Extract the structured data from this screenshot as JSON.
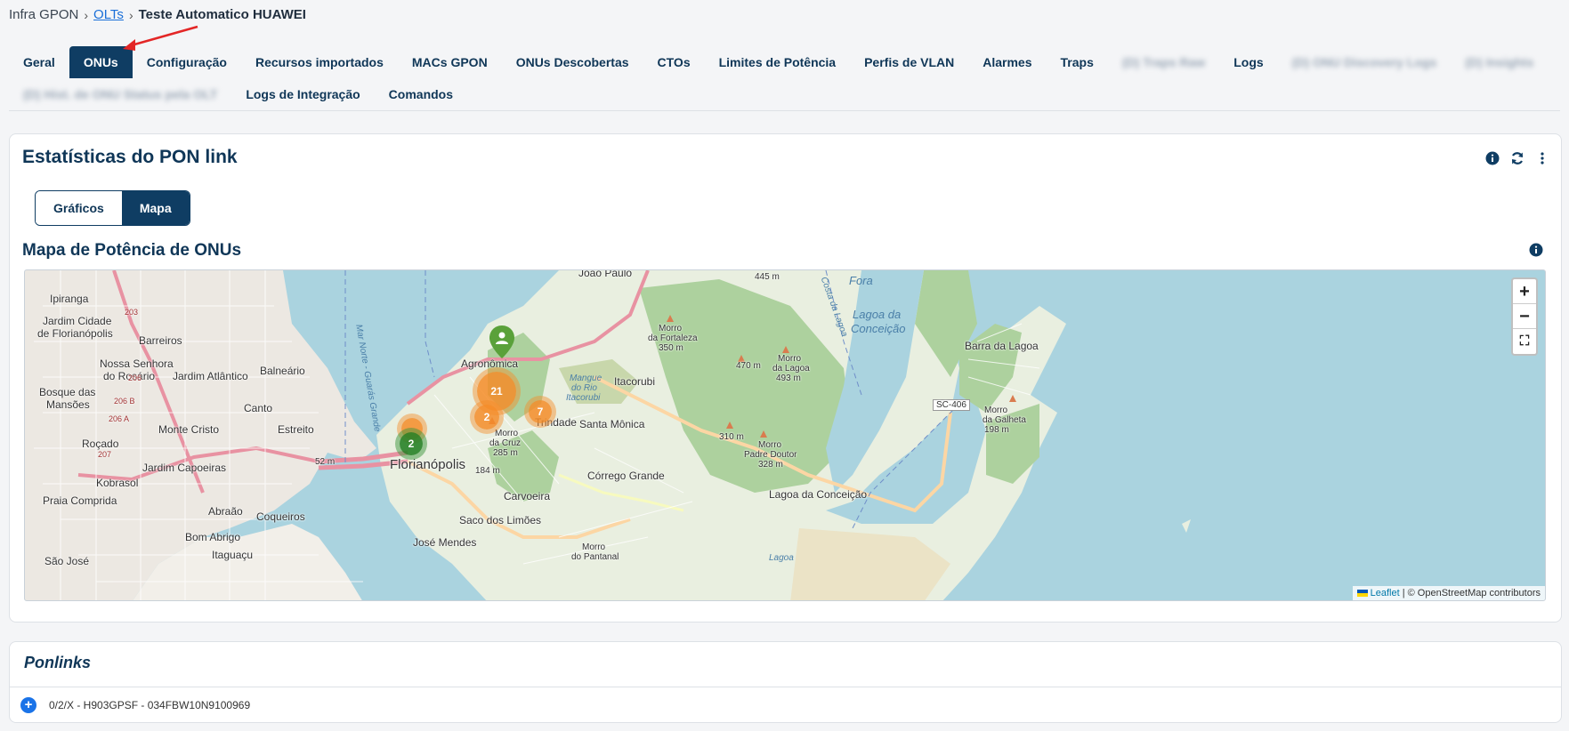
{
  "breadcrumb": {
    "root": "Infra GPON",
    "link": "OLTs",
    "current": "Teste Automatico HUAWEI"
  },
  "tabs_row1": [
    {
      "label": "Geral",
      "active": false,
      "blur": false
    },
    {
      "label": "ONUs",
      "active": true,
      "blur": false
    },
    {
      "label": "Configuração",
      "active": false,
      "blur": false
    },
    {
      "label": "Recursos importados",
      "active": false,
      "blur": false
    },
    {
      "label": "MACs GPON",
      "active": false,
      "blur": false
    },
    {
      "label": "ONUs Descobertas",
      "active": false,
      "blur": false
    },
    {
      "label": "CTOs",
      "active": false,
      "blur": false
    },
    {
      "label": "Limites de Potência",
      "active": false,
      "blur": false
    },
    {
      "label": "Perfis de VLAN",
      "active": false,
      "blur": false
    },
    {
      "label": "Alarmes",
      "active": false,
      "blur": false
    },
    {
      "label": "Traps",
      "active": false,
      "blur": false
    },
    {
      "label": "(D) Traps Raw",
      "active": false,
      "blur": true
    },
    {
      "label": "Logs",
      "active": false,
      "blur": false
    },
    {
      "label": "(D) ONU Discovery Logs",
      "active": false,
      "blur": true
    },
    {
      "label": "(D) Insights",
      "active": false,
      "blur": true
    }
  ],
  "tabs_row2": [
    {
      "label": "(D) Hist. de ONU Status pela OLT",
      "active": false,
      "blur": true
    },
    {
      "label": "Logs de Integração",
      "active": false,
      "blur": false
    },
    {
      "label": "Comandos",
      "active": false,
      "blur": false
    }
  ],
  "stats_card": {
    "title": "Estatísticas do PON link",
    "toggle_graphs": "Gráficos",
    "toggle_map": "Mapa",
    "map_title": "Mapa de Potência de ONUs"
  },
  "map": {
    "zoom_in": "+",
    "zoom_out": "−",
    "fullscreen": "⛶",
    "attribution_leaflet": "Leaflet",
    "attribution_rest": "| © OpenStreetMap contributors",
    "clusters": [
      {
        "count": "21",
        "color": "orange"
      },
      {
        "count": "2",
        "color": "orange"
      },
      {
        "count": "7",
        "color": "orange"
      },
      {
        "count": "",
        "color": "orange"
      },
      {
        "count": "2",
        "color": "green"
      }
    ],
    "labels": {
      "joao_paulo": "João Paulo",
      "ipiranga": "Ipiranga",
      "jardim_cidade": "Jardim Cidade",
      "de_florianopolis": "de Florianópolis",
      "barreiros": "Barreiros",
      "nossa_senhora": "Nossa Senhora",
      "do_rosario": "do Rosário",
      "jardim_atlantico": "Jardim Atlântico",
      "balneario": "Balneário",
      "bosque": "Bosque das",
      "mansoes": "Mansões",
      "canto": "Canto",
      "monte_cristo": "Monte Cristo",
      "estreito": "Estreito",
      "rocado": "Roçado",
      "jardim_capoeiras": "Jardim Capoeiras",
      "kobrasol": "Kobrasol",
      "praia_comprida": "Praia Comprida",
      "abraao": "Abraão",
      "coqueiros": "Coqueiros",
      "bom_abrigo": "Bom Abrigo",
      "itaguacu": "Itaguaçu",
      "sao_jose": "São José",
      "agronomica": "Agronômica",
      "florianopolis": "Florianópolis",
      "itacorubi": "Itacorubi",
      "santa_monica": "Santa Mônica",
      "trindade": "Trindade",
      "corrego_grande": "Córrego Grande",
      "carvoeira": "Carvoeira",
      "saco_dos_limoes": "Saco dos Limões",
      "jose_mendes": "José Mendes",
      "lagoa_conceicao": "Lagoa da Conceição",
      "lagoa_da": "Lagoa da",
      "conceicao": "Conceição",
      "barra_lagoa": "Barra da Lagoa",
      "morro_fortaleza": "Morro",
      "morro_fortaleza2": "da Fortaleza",
      "morro_fortaleza3": "350 m",
      "m470": "470 m",
      "morro_lagoa": "Morro",
      "morro_lagoa2": "da Lagoa",
      "morro_lagoa3": "493 m",
      "m310": "310 m",
      "padre_doutor": "Morro",
      "padre_doutor2": "Padre Doutor",
      "padre_doutor3": "328 m",
      "galheta": "Morro",
      "galheta2": "da Galheta",
      "galheta3": "198 m",
      "sc406": "SC-406",
      "m445": "445 m",
      "fora": "Fora",
      "morro_cruz": "Morro",
      "morro_cruz2": "da Cruz",
      "morro_cruz3": "285 m",
      "m184": "184 m",
      "mangue": "Mangue",
      "mangue2": "do Rio",
      "mangue3": "Itacorubi",
      "mar_norte": "Mar Norte - Guarás Grande",
      "costa_lagoa": "Costa da Lagoa",
      "morro_pantanal": "Morro",
      "morro_pantanal2": "do Pantanal",
      "lagoa_bottom": "Lagoa",
      "m52": "52 m",
      "r203": "203",
      "r206": "206",
      "r207": "207",
      "r206b": "206 B",
      "r206a": "206 A"
    }
  },
  "ponlinks": {
    "title": "Ponlinks",
    "items": [
      {
        "label": "0/2/X - H903GPSF - 034FBW10N9100969"
      }
    ]
  },
  "colors": {
    "primary": "#0f3d63",
    "cluster_orange": "#f58c28",
    "cluster_green": "#2b8a2b",
    "accent_arrow": "#e32626"
  }
}
